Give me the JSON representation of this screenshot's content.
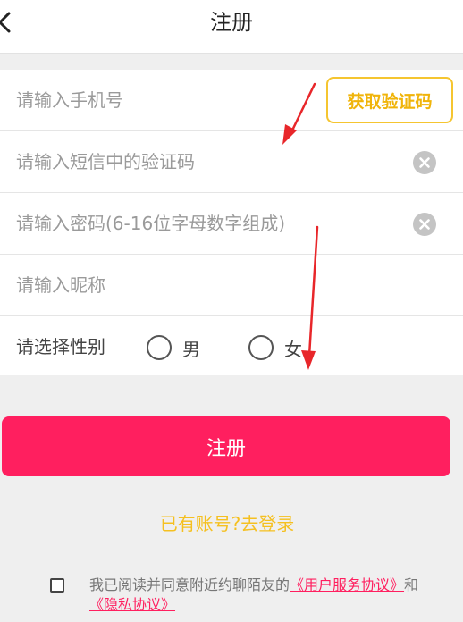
{
  "header": {
    "title": "注册"
  },
  "form": {
    "phone_placeholder": "请输入手机号",
    "get_code_label": "获取验证码",
    "code_placeholder": "请输入短信中的验证码",
    "password_placeholder": "请输入密码(6-16位字母数字组成)",
    "nickname_placeholder": "请输入昵称",
    "gender_label": "请选择性别",
    "gender_male": "男",
    "gender_female": "女"
  },
  "submit_label": "注册",
  "login_link": "已有账号?去登录",
  "agreement": {
    "prefix": "我已阅读并同意附近约聊陌友的",
    "user_agreement": "《用户服务协议》",
    "joiner": "和",
    "privacy_agreement": "《隐私协议》"
  },
  "colors": {
    "accent_pink": "#ff1f5f",
    "accent_yellow": "#f5c530",
    "annotation_red": "#e8262a"
  },
  "icons": [
    "back-arrow-icon",
    "clear-icon",
    "radio-icon",
    "checkbox-icon"
  ]
}
